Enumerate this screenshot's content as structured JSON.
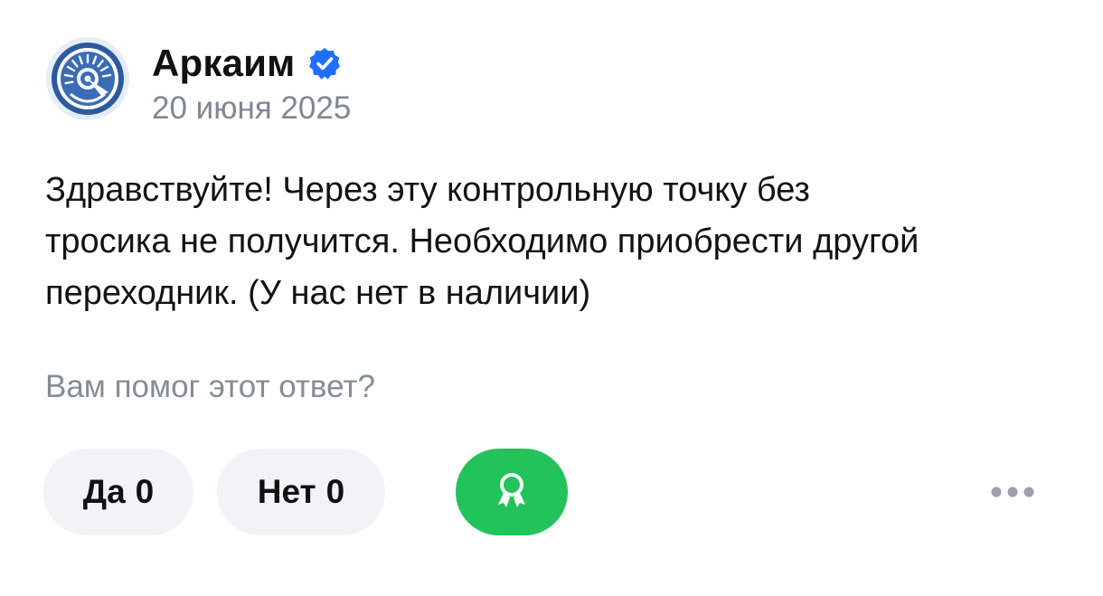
{
  "author": {
    "name": "Аркаим",
    "date": "20 июня 2025",
    "avatar_icon": "arkaim-logo-icon",
    "verified_icon": "verified-check-icon"
  },
  "message": {
    "lines": [
      "Здравствуйте! Через эту контрольную точку без",
      "тросика не получится. Необходимо приобрести другой",
      "переходник. (У нас нет в наличии)"
    ]
  },
  "feedback": {
    "question": "Вам помог этот ответ?",
    "yes_label": "Да",
    "yes_count": "0",
    "no_label": "Нет",
    "no_count": "0",
    "reward_icon": "award-badge-icon",
    "more_icon": "more-dots-icon"
  },
  "colors": {
    "accent_green": "#22c35a",
    "verified_blue": "#1f6fff",
    "pill_bg": "#f2f3f7",
    "muted_text": "#7f8791",
    "avatar_blue": "#2c5a9e"
  }
}
